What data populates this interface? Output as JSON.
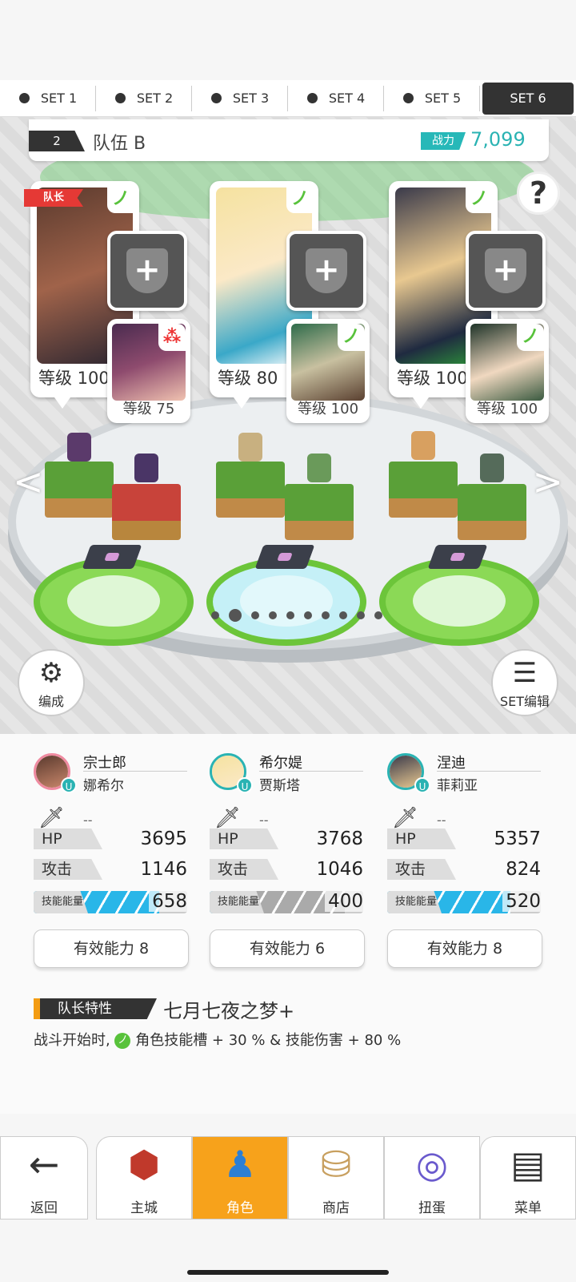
{
  "set_tabs": [
    {
      "label": "SET 1",
      "active": false
    },
    {
      "label": "SET 2",
      "active": false
    },
    {
      "label": "SET 3",
      "active": false
    },
    {
      "label": "SET 4",
      "active": false
    },
    {
      "label": "SET 5",
      "active": false
    },
    {
      "label": "SET 6",
      "active": true
    }
  ],
  "team": {
    "number": "2",
    "name": "队伍 B",
    "power_label": "战力",
    "power_value": "7,099"
  },
  "help_icon": "?",
  "leader_ribbon": "队长",
  "slots": [
    {
      "main_level": "等级 100",
      "sub_level": "等级 75",
      "main_elem": "leaf",
      "sub_elem": "dots"
    },
    {
      "main_level": "等级 80",
      "sub_level": "等级 100",
      "main_elem": "leaf",
      "sub_elem": "leaf"
    },
    {
      "main_level": "等级 100",
      "sub_level": "等级 100",
      "main_elem": "leaf",
      "sub_elem": "leaf"
    }
  ],
  "arena": {
    "page_count": 10,
    "active_page": 2
  },
  "formation_button": "编成",
  "set_edit_button": "SET编辑",
  "characters": [
    {
      "name": "宗士郎",
      "subname": "娜希尔",
      "weapon": "--",
      "hp_label": "HP",
      "hp": "3695",
      "atk_label": "攻击",
      "atk": "1146",
      "energy_label": "技能能量",
      "energy": "658",
      "energy_fill": 0.82,
      "energy_color": "blue",
      "effective": "有效能力 8"
    },
    {
      "name": "希尔媞",
      "subname": "贾斯塔",
      "weapon": "--",
      "hp_label": "HP",
      "hp": "3768",
      "atk_label": "攻击",
      "atk": "1046",
      "energy_label": "技能能量",
      "energy": "400",
      "energy_fill": 0.88,
      "energy_color": "mixed",
      "effective": "有效能力 6"
    },
    {
      "name": "涅迪",
      "subname": "菲莉亚",
      "weapon": "--",
      "hp_label": "HP",
      "hp": "5357",
      "atk_label": "攻击",
      "atk": "824",
      "energy_label": "技能能量",
      "energy": "520",
      "energy_fill": 0.8,
      "energy_color": "blue",
      "effective": "有效能力 8"
    }
  ],
  "leader": {
    "tag": "队长特性",
    "skill_name": "七月七夜之梦+",
    "desc_prefix": "战斗开始时,",
    "desc_suffix": "角色技能槽 + 30 % & 技能伤害 + 80 %"
  },
  "nav": [
    {
      "label": "返回",
      "icon": "back-arrow-icon"
    },
    {
      "label": "主城",
      "icon": "castle-icon"
    },
    {
      "label": "角色",
      "icon": "character-icon",
      "active": true
    },
    {
      "label": "商店",
      "icon": "shop-icon"
    },
    {
      "label": "扭蛋",
      "icon": "gacha-icon"
    },
    {
      "label": "菜单",
      "icon": "menu-icon"
    }
  ],
  "colors": {
    "accent_teal": "#2ab3b3",
    "active_nav": "#f7a21b",
    "leader_red": "#e53935",
    "energy_blue": "#29b6e8"
  }
}
